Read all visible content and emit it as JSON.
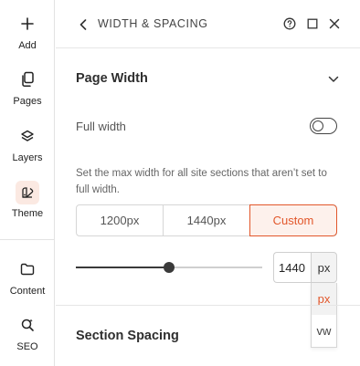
{
  "rail": {
    "items": [
      {
        "label": "Add",
        "icon": "plus-icon"
      },
      {
        "label": "Pages",
        "icon": "pages-icon"
      },
      {
        "label": "Layers",
        "icon": "layers-icon"
      },
      {
        "label": "Theme",
        "icon": "theme-icon",
        "active": true
      },
      {
        "label": "Content",
        "icon": "folder-icon"
      },
      {
        "label": "SEO",
        "icon": "seo-search-icon"
      }
    ]
  },
  "header": {
    "title": "WIDTH & SPACING"
  },
  "page_width": {
    "title": "Page Width",
    "full_width_label": "Full width",
    "full_width_on": false,
    "description": "Set the max width for all site sections that aren’t set to full width.",
    "presets": [
      "1200px",
      "1440px",
      "Custom"
    ],
    "selected_preset": "Custom",
    "slider_fraction": 0.5,
    "value": "1440",
    "unit": "px",
    "unit_options": [
      "px",
      "vw"
    ],
    "highlighted_unit": "px"
  },
  "section_spacing": {
    "title": "Section Spacing"
  },
  "colors": {
    "accent": "#e2572b",
    "accent_bg": "#fdf1ec",
    "text": "#2b2b2b"
  }
}
